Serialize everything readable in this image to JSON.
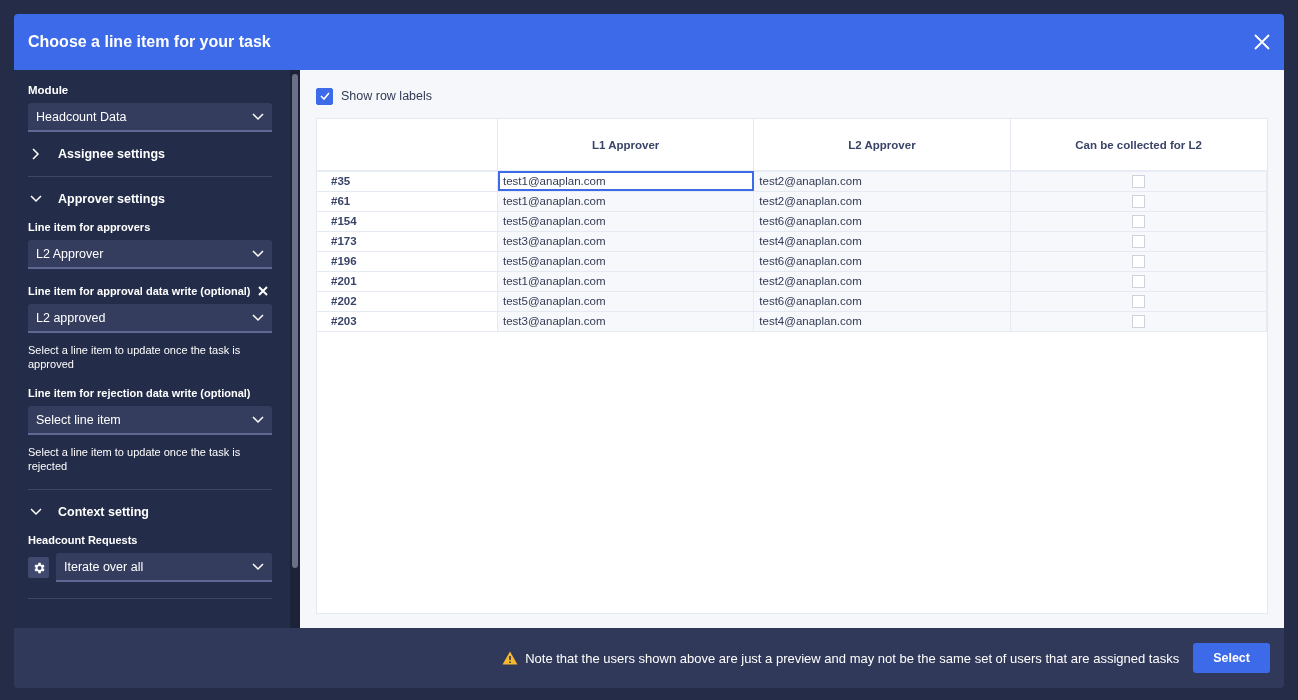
{
  "dialog": {
    "title": "Choose a line item for your task"
  },
  "sidebar": {
    "module": {
      "label": "Module",
      "value": "Headcount Data"
    },
    "sections": [
      {
        "title": "Assignee settings",
        "expanded": false
      },
      {
        "title": "Approver settings",
        "expanded": true,
        "fields": [
          {
            "kind": "select",
            "label": "Line item for approvers",
            "value": "L2 Approver",
            "clearable": false
          },
          {
            "kind": "select",
            "label": "Line item for approval data write (optional)",
            "value": "L2 approved",
            "clearable": true,
            "help": "Select a line item to update once the task is approved"
          },
          {
            "kind": "select",
            "label": "Line item for rejection data write (optional)",
            "value": "Select line item",
            "clearable": false,
            "help": "Select a line item to update once the task is rejected"
          }
        ]
      },
      {
        "title": "Context setting",
        "expanded": true,
        "fields": [
          {
            "kind": "gear_select",
            "label": "Headcount Requests",
            "value": "Iterate over all",
            "clearable": false
          }
        ]
      }
    ]
  },
  "show_row_labels": {
    "label": "Show row labels",
    "checked": true
  },
  "table": {
    "columns": [
      "L1 Approver",
      "L2 Approver",
      "Can be collected for L2"
    ],
    "rows": [
      {
        "label": "#35",
        "l1": "test1@anaplan.com",
        "l2": "test2@anaplan.com",
        "collected": false,
        "focused": true
      },
      {
        "label": "#61",
        "l1": "test1@anaplan.com",
        "l2": "test2@anaplan.com",
        "collected": false,
        "focused": false
      },
      {
        "label": "#154",
        "l1": "test5@anaplan.com",
        "l2": "test6@anaplan.com",
        "collected": false,
        "focused": false
      },
      {
        "label": "#173",
        "l1": "test3@anaplan.com",
        "l2": "test4@anaplan.com",
        "collected": false,
        "focused": false
      },
      {
        "label": "#196",
        "l1": "test5@anaplan.com",
        "l2": "test6@anaplan.com",
        "collected": false,
        "focused": false
      },
      {
        "label": "#201",
        "l1": "test1@anaplan.com",
        "l2": "test2@anaplan.com",
        "collected": false,
        "focused": false
      },
      {
        "label": "#202",
        "l1": "test5@anaplan.com",
        "l2": "test6@anaplan.com",
        "collected": false,
        "focused": false
      },
      {
        "label": "#203",
        "l1": "test3@anaplan.com",
        "l2": "test4@anaplan.com",
        "collected": false,
        "focused": false
      }
    ]
  },
  "footer": {
    "note": "Note that the users shown above are just a preview and may not be the same set of users that are assigned tasks",
    "button": "Select"
  }
}
